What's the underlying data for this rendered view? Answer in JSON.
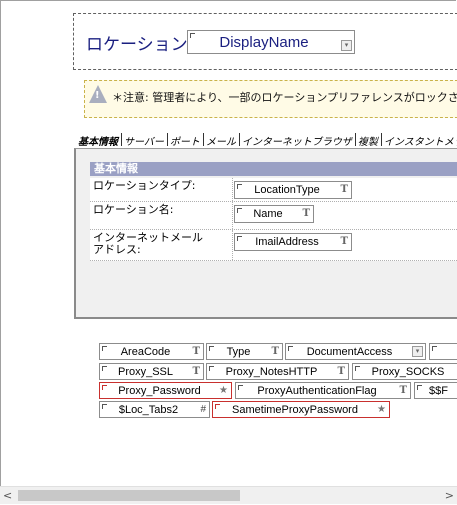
{
  "title": {
    "label": "ロケーション",
    "field_name": "DisplayName"
  },
  "note": {
    "text": "＊注意: 管理者により、一部のロケーションプリファレンスがロックされ"
  },
  "tabs": [
    "基本情報",
    "サーバー",
    "ポート",
    "メール",
    "インターネットブラウザ",
    "複製",
    "インスタントメッ"
  ],
  "section": {
    "header": "基本情報",
    "rows": [
      {
        "label": "ロケーションタイプ:",
        "field": "LocationType",
        "type": "T"
      },
      {
        "label": "ロケーション名:",
        "field": "Name",
        "type": "T"
      },
      {
        "label": "インターネットメール\nアドレス:",
        "field": "ImailAddress",
        "type": "T"
      }
    ]
  },
  "hidden_fields": {
    "row1": [
      {
        "name": "AreaCode",
        "type": "T"
      },
      {
        "name": "Type",
        "type": "T"
      },
      {
        "name": "DocumentAccess",
        "type": ""
      }
    ],
    "row2": [
      {
        "name": "Proxy_SSL",
        "type": "T"
      },
      {
        "name": "Proxy_NotesHTTP",
        "type": "T"
      },
      {
        "name": "Proxy_SOCKS",
        "type": ""
      }
    ],
    "row3": [
      {
        "name": "Proxy_Password",
        "type": "★"
      },
      {
        "name": "ProxyAuthenticationFlag",
        "type": "T"
      },
      {
        "name": "$$F",
        "type": ""
      }
    ],
    "row4": [
      {
        "name": "$Loc_Tabs2",
        "type": "#"
      },
      {
        "name": "SametimeProxyPassword",
        "type": "★"
      }
    ]
  },
  "icons": {
    "note": "warning-icon",
    "combo": "dropdown-icon",
    "scroll_left": "chevron-left-icon",
    "scroll_right": "chevron-right-icon"
  },
  "colors": {
    "title_text": "#1a1f80",
    "section_header": "#9aa0c4",
    "encrypted_border": "#c8302e"
  }
}
